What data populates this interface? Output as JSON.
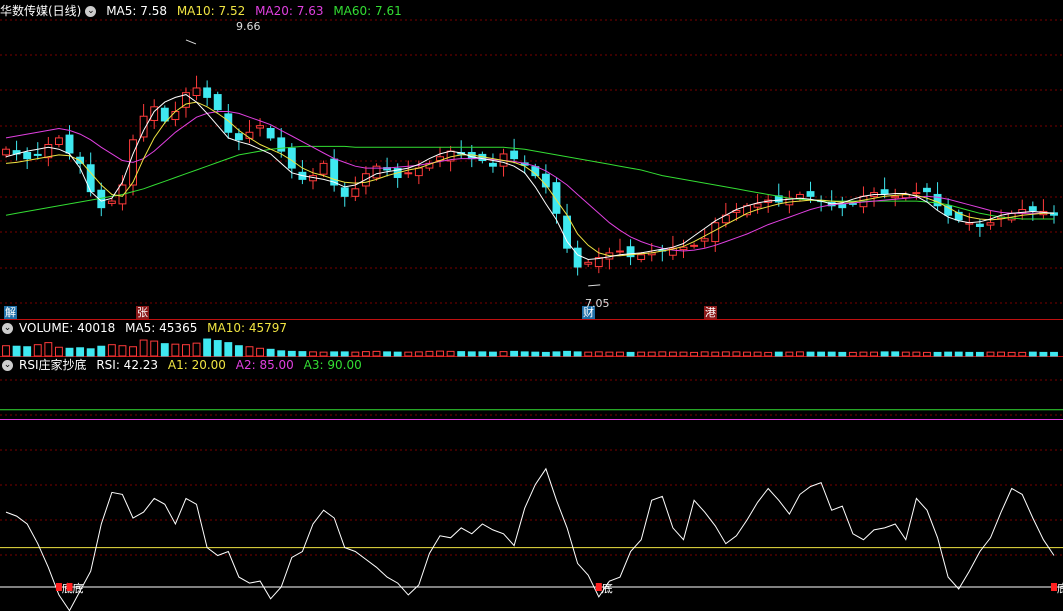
{
  "main_header": {
    "title": "华数传媒(日线)",
    "items": [
      {
        "label": "MA5: 7.58",
        "color": "#ffffff"
      },
      {
        "label": "MA10: 7.52",
        "color": "#f0e442"
      },
      {
        "label": "MA20: 7.63",
        "color": "#e040e0"
      },
      {
        "label": "MA60: 7.61",
        "color": "#33dd33"
      }
    ]
  },
  "volume_header": {
    "title": "VOLUME: 40018",
    "items": [
      {
        "label": "MA5: 45365",
        "color": "#ffffff"
      },
      {
        "label": "MA10: 45797",
        "color": "#f0e442"
      }
    ]
  },
  "rsi_header": {
    "title": "RSI庄家抄底",
    "items": [
      {
        "label": "RSI: 42.23",
        "color": "#ffffff"
      },
      {
        "label": "A1: 20.00",
        "color": "#f0e442"
      },
      {
        "label": "A2: 85.00",
        "color": "#e040e0"
      },
      {
        "label": "A3: 90.00",
        "color": "#33dd33"
      }
    ]
  },
  "annotations": {
    "high": "9.66",
    "low": "7.05"
  },
  "event_markers": [
    {
      "label": "解",
      "bg": "#1f6fa8"
    },
    {
      "label": "张",
      "bg": "#8b1a1a"
    },
    {
      "label": "财",
      "bg": "#1f6fa8"
    },
    {
      "label": "港",
      "bg": "#8b1a1a"
    }
  ],
  "signal_label": "底",
  "colors": {
    "up": "#ff3b3b",
    "down": "#3fe8f0",
    "grid": "#7a0000",
    "ma5": "#ffffff",
    "ma10": "#f0e442",
    "ma20": "#e040e0",
    "ma60": "#33dd33"
  },
  "chart_data": [
    {
      "type": "candlestick",
      "title": "华数传媒(日线)",
      "ylim": [
        6.9,
        9.85
      ],
      "high_marker": 9.66,
      "low_marker": 7.05,
      "series_names": [
        "MA5",
        "MA10",
        "MA20",
        "MA60"
      ],
      "closes": [
        8.5,
        8.45,
        8.4,
        8.44,
        8.55,
        8.62,
        8.46,
        8.35,
        8.05,
        7.88,
        7.95,
        8.12,
        8.6,
        8.85,
        8.95,
        8.8,
        8.9,
        9.1,
        9.15,
        9.05,
        8.92,
        8.68,
        8.6,
        8.68,
        8.75,
        8.62,
        8.48,
        8.3,
        8.18,
        8.22,
        8.35,
        8.12,
        8.0,
        8.08,
        8.24,
        8.32,
        8.28,
        8.2,
        8.25,
        8.3,
        8.35,
        8.42,
        8.48,
        8.45,
        8.4,
        8.38,
        8.32,
        8.45,
        8.4,
        8.33,
        8.22,
        8.1,
        7.82,
        7.45,
        7.25,
        7.3,
        7.35,
        7.4,
        7.42,
        7.36,
        7.38,
        7.4,
        7.42,
        7.45,
        7.46,
        7.48,
        7.55,
        7.72,
        7.8,
        7.85,
        7.9,
        7.92,
        7.96,
        7.94,
        7.98,
        8.02,
        8.0,
        7.95,
        7.9,
        7.88,
        7.92,
        8.0,
        8.04,
        8.03,
        8.0,
        8.02,
        8.04,
        8.05,
        7.9,
        7.8,
        7.75,
        7.72,
        7.68,
        7.72,
        7.78,
        7.82,
        7.86,
        7.85,
        7.84,
        7.8
      ],
      "ma5": [
        8.42,
        8.45,
        8.48,
        8.5,
        8.52,
        8.5,
        8.45,
        8.3,
        8.05,
        7.95,
        7.98,
        8.15,
        8.45,
        8.7,
        8.9,
        9.0,
        9.05,
        9.08,
        9.0,
        8.88,
        8.75,
        8.62,
        8.58,
        8.55,
        8.5,
        8.45,
        8.35,
        8.25,
        8.22,
        8.2,
        8.18,
        8.15,
        8.1,
        8.12,
        8.18,
        8.24,
        8.26,
        8.28,
        8.3,
        8.34,
        8.4,
        8.45,
        8.48,
        8.46,
        8.42,
        8.4,
        8.38,
        8.36,
        8.32,
        8.25,
        8.1,
        7.92,
        7.75,
        7.52,
        7.38,
        7.33,
        7.34,
        7.36,
        7.38,
        7.39,
        7.4,
        7.42,
        7.44,
        7.46,
        7.5,
        7.58,
        7.66,
        7.74,
        7.8,
        7.86,
        7.9,
        7.93,
        7.95,
        7.96,
        7.97,
        7.98,
        7.97,
        7.95,
        7.92,
        7.93,
        7.97,
        8.0,
        8.02,
        8.02,
        8.03,
        8.03,
        8.0,
        7.94,
        7.85,
        7.78,
        7.74,
        7.72,
        7.73,
        7.76,
        7.8,
        7.82,
        7.83,
        7.84,
        7.83,
        7.82
      ],
      "ma10": [
        8.35,
        8.36,
        8.38,
        8.4,
        8.42,
        8.44,
        8.43,
        8.38,
        8.25,
        8.12,
        8.02,
        8.0,
        8.15,
        8.4,
        8.62,
        8.78,
        8.9,
        8.98,
        9.0,
        8.95,
        8.88,
        8.8,
        8.7,
        8.62,
        8.55,
        8.5,
        8.45,
        8.38,
        8.3,
        8.25,
        8.22,
        8.18,
        8.15,
        8.14,
        8.15,
        8.18,
        8.22,
        8.25,
        8.28,
        8.3,
        8.34,
        8.38,
        8.42,
        8.44,
        8.44,
        8.42,
        8.4,
        8.38,
        8.36,
        8.32,
        8.24,
        8.12,
        7.96,
        7.8,
        7.6,
        7.48,
        7.4,
        7.37,
        7.37,
        7.38,
        7.39,
        7.4,
        7.42,
        7.44,
        7.47,
        7.52,
        7.58,
        7.64,
        7.7,
        7.76,
        7.82,
        7.86,
        7.89,
        7.92,
        7.94,
        7.95,
        7.96,
        7.96,
        7.95,
        7.94,
        7.94,
        7.96,
        7.98,
        8.0,
        8.01,
        8.02,
        8.01,
        7.98,
        7.94,
        7.88,
        7.82,
        7.78,
        7.76,
        7.75,
        7.76,
        7.78,
        7.8,
        7.81,
        7.82,
        7.82
      ],
      "ma20": [
        8.62,
        8.64,
        8.66,
        8.68,
        8.7,
        8.72,
        8.7,
        8.66,
        8.6,
        8.52,
        8.45,
        8.38,
        8.36,
        8.4,
        8.48,
        8.58,
        8.68,
        8.76,
        8.84,
        8.88,
        8.9,
        8.9,
        8.88,
        8.84,
        8.8,
        8.76,
        8.7,
        8.64,
        8.58,
        8.52,
        8.46,
        8.4,
        8.36,
        8.32,
        8.3,
        8.3,
        8.3,
        8.31,
        8.32,
        8.33,
        8.35,
        8.37,
        8.39,
        8.4,
        8.4,
        8.4,
        8.39,
        8.38,
        8.37,
        8.35,
        8.32,
        8.27,
        8.2,
        8.12,
        8.02,
        7.92,
        7.82,
        7.72,
        7.64,
        7.57,
        7.52,
        7.48,
        7.45,
        7.43,
        7.42,
        7.43,
        7.45,
        7.48,
        7.52,
        7.56,
        7.6,
        7.65,
        7.7,
        7.74,
        7.78,
        7.82,
        7.86,
        7.89,
        7.91,
        7.92,
        7.93,
        7.94,
        7.95,
        7.96,
        7.97,
        7.98,
        7.99,
        8.0,
        7.99,
        7.97,
        7.94,
        7.91,
        7.88,
        7.85,
        7.83,
        7.82,
        7.82,
        7.82,
        7.82,
        7.82
      ],
      "ma60": [
        7.8,
        7.82,
        7.84,
        7.86,
        7.88,
        7.9,
        7.92,
        7.94,
        7.96,
        7.98,
        8.0,
        8.02,
        8.05,
        8.08,
        8.12,
        8.16,
        8.2,
        8.24,
        8.28,
        8.32,
        8.36,
        8.4,
        8.44,
        8.46,
        8.48,
        8.5,
        8.51,
        8.52,
        8.53,
        8.53,
        8.53,
        8.53,
        8.53,
        8.52,
        8.52,
        8.52,
        8.52,
        8.52,
        8.52,
        8.52,
        8.52,
        8.52,
        8.52,
        8.52,
        8.52,
        8.52,
        8.52,
        8.52,
        8.51,
        8.5,
        8.48,
        8.46,
        8.44,
        8.42,
        8.4,
        8.38,
        8.36,
        8.34,
        8.32,
        8.3,
        8.28,
        8.25,
        8.22,
        8.2,
        8.18,
        8.16,
        8.14,
        8.12,
        8.1,
        8.08,
        8.06,
        8.04,
        8.02,
        8.0,
        7.98,
        7.97,
        7.96,
        7.95,
        7.95,
        7.95,
        7.95,
        7.95,
        7.95,
        7.95,
        7.95,
        7.95,
        7.95,
        7.94,
        7.93,
        7.91,
        7.88,
        7.85,
        7.82,
        7.8,
        7.78,
        7.77,
        7.76,
        7.76,
        7.76,
        7.76
      ]
    },
    {
      "type": "bar",
      "title": "VOLUME",
      "values": [
        40,
        38,
        36,
        44,
        52,
        34,
        30,
        32,
        28,
        38,
        44,
        40,
        36,
        62,
        58,
        48,
        46,
        44,
        50,
        66,
        60,
        52,
        40,
        36,
        30,
        26,
        20,
        18,
        17,
        16,
        15,
        16,
        16,
        15,
        17,
        18,
        16,
        15,
        15,
        16,
        18,
        19,
        18,
        17,
        16,
        16,
        15,
        17,
        18,
        16,
        15,
        14,
        16,
        18,
        16,
        15,
        16,
        15,
        15,
        14,
        15,
        15,
        16,
        15,
        15,
        14,
        16,
        15,
        16,
        16,
        15,
        15,
        14,
        15,
        15,
        16,
        15,
        15,
        15,
        14,
        14,
        15,
        15,
        16,
        16,
        15,
        15,
        14,
        14,
        15,
        15,
        14,
        14,
        15,
        15,
        14,
        14,
        15,
        14,
        14
      ]
    },
    {
      "type": "line",
      "title": "RSI庄家抄底",
      "ylim": [
        0,
        100
      ],
      "hlines": {
        "A1": 20.0,
        "A2": 85.0,
        "A3": 90.0
      },
      "values": [
        38,
        36,
        32,
        22,
        10,
        -4,
        -12,
        -2,
        8,
        32,
        48,
        47,
        35,
        38,
        45,
        42,
        32,
        45,
        42,
        20,
        16,
        18,
        5,
        2,
        3,
        -6,
        0,
        15,
        18,
        32,
        39,
        35,
        20,
        18,
        14,
        10,
        5,
        2,
        -4,
        1,
        17,
        26,
        25,
        30,
        27,
        32,
        29,
        27,
        21,
        40,
        52,
        60,
        44,
        30,
        12,
        6,
        -5,
        3,
        5,
        18,
        24,
        44,
        46,
        30,
        24,
        44,
        38,
        31,
        22,
        26,
        34,
        43,
        50,
        44,
        37,
        47,
        51,
        53,
        39,
        41,
        27,
        24,
        29,
        30,
        32,
        24,
        45,
        39,
        25,
        5,
        -1,
        8,
        18,
        25,
        38,
        50,
        47,
        35,
        24,
        16
      ],
      "signals": [
        5,
        6,
        56,
        99
      ]
    }
  ]
}
